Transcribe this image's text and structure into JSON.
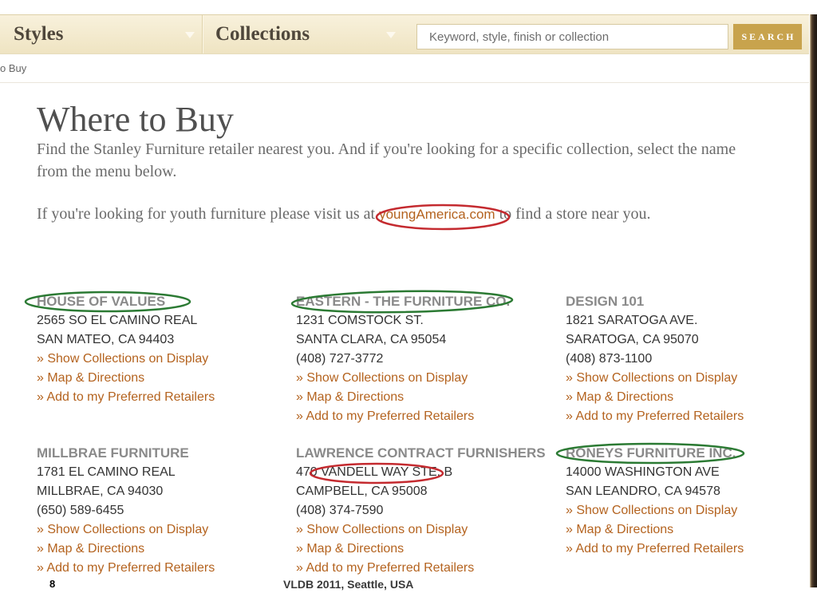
{
  "nav": {
    "styles": {
      "label": "Styles",
      "icon": "caret-down-icon"
    },
    "collections": {
      "label": "Collections",
      "icon": "caret-down-icon"
    },
    "search": {
      "placeholder": "Keyword, style, finish or collection",
      "value": "",
      "button_label": "SEARCH"
    }
  },
  "breadcrumb": {
    "text": "o Buy"
  },
  "page": {
    "title": "Where to Buy",
    "intro_line1": "Find the Stanley Furniture retailer nearest you. And if you're looking for a specific collection, select the name",
    "intro_line2": "from the menu below.",
    "youth_prefix": "If you're looking for youth furniture please visit us at",
    "youth_link": "youngAmerica.com",
    "youth_suffix": "to find a store near you."
  },
  "retailers": [
    {
      "name": "HOUSE OF VALUES",
      "address": "2565 SO EL CAMINO REAL",
      "city": "SAN MATEO, CA 94403",
      "links": {
        "collections": "» Show Collections on Display",
        "map": "» Map & Directions",
        "preferred": "» Add to my Preferred Retailers"
      }
    },
    {
      "name": "EASTERN - THE FURNITURE CO.",
      "address": "1231 COMSTOCK ST.",
      "city": "SANTA CLARA, CA 95054",
      "phone": "(408) 727-3772",
      "links": {
        "collections": "» Show Collections on Display",
        "map": "» Map & Directions",
        "preferred": "» Add to my Preferred Retailers"
      }
    },
    {
      "name": "DESIGN 101",
      "address": "1821 SARATOGA AVE.",
      "city": "SARATOGA, CA 95070",
      "phone": "(408) 873-1100",
      "links": {
        "collections": "» Show Collections on Display",
        "map": "» Map & Directions",
        "preferred": "» Add to my Preferred Retailers"
      }
    },
    {
      "name": "MILLBRAE FURNITURE",
      "address": "1781 EL CAMINO REAL",
      "city": "MILLBRAE, CA 94030",
      "phone": "(650) 589-6455",
      "links": {
        "collections": "» Show Collections on Display",
        "map": "» Map & Directions",
        "preferred": "» Add to my Preferred Retailers"
      }
    },
    {
      "name": "LAWRENCE CONTRACT FURNISHERS",
      "address": "470 VANDELL WAY STE. B",
      "city": "CAMPBELL, CA 95008",
      "phone": "(408) 374-7590",
      "links": {
        "collections": "» Show Collections on Display",
        "map": "» Map & Directions",
        "preferred": "» Add to my Preferred Retailers"
      }
    },
    {
      "name": "RONEYS FURNITURE INC.",
      "address": "14000 WASHINGTON AVE",
      "city": "SAN LEANDRO, CA 94578",
      "links": {
        "collections": "» Show Collections on Display",
        "map": "» Map & Directions",
        "preferred": "» Add to my Preferred Retailers"
      }
    }
  ],
  "slide_footer": {
    "page_number": "8",
    "venue": "VLDB 2011, Seattle, USA"
  },
  "colors": {
    "nav_bar": "#efe4c2",
    "search_button": "#c8a34d",
    "link": "#b4631f",
    "retailer_name": "#8a8a8a",
    "heading": "#505050",
    "body_text": "#6a6a6a",
    "frame": "#5b4631",
    "annotation_red": "#c42a2f",
    "annotation_green": "#2b7a33"
  }
}
